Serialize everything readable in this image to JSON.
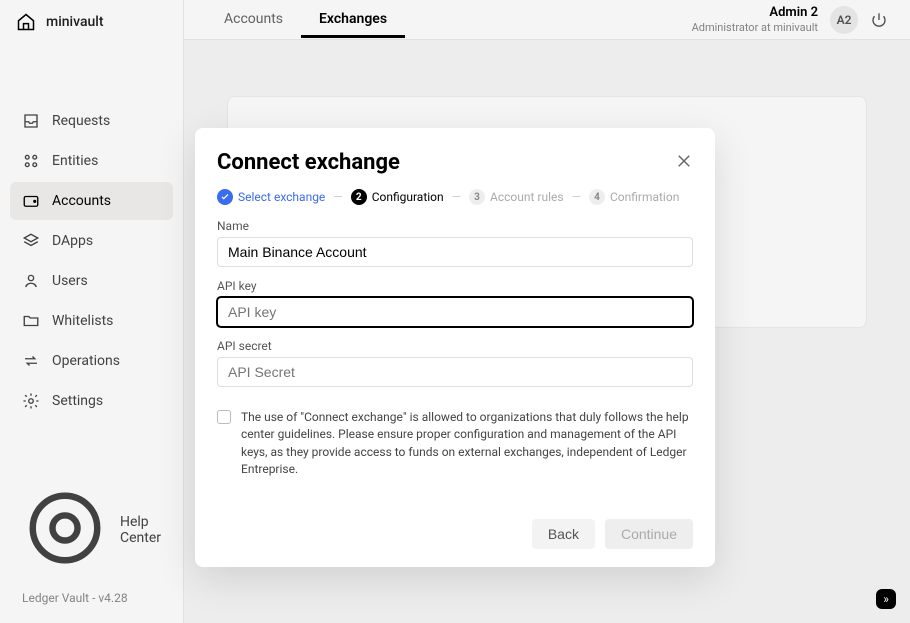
{
  "workspace": "minivault",
  "sidebar": {
    "items": [
      {
        "label": "Requests"
      },
      {
        "label": "Entities"
      },
      {
        "label": "Accounts"
      },
      {
        "label": "DApps"
      },
      {
        "label": "Users"
      },
      {
        "label": "Whitelists"
      },
      {
        "label": "Operations"
      },
      {
        "label": "Settings"
      }
    ],
    "help": "Help Center",
    "version": "Ledger Vault - v4.28"
  },
  "topbar": {
    "tabs": [
      {
        "label": "Accounts"
      },
      {
        "label": "Exchanges"
      }
    ],
    "user_name": "Admin 2",
    "user_role": "Administrator at minivault",
    "avatar": "A2"
  },
  "modal": {
    "title": "Connect exchange",
    "steps": [
      {
        "label": "Select exchange"
      },
      {
        "label": "Configuration"
      },
      {
        "label": "Account rules"
      },
      {
        "label": "Confirmation"
      }
    ],
    "step_numbers": {
      "s2": "2",
      "s3": "3",
      "s4": "4"
    },
    "name_label": "Name",
    "name_value": "Main Binance Account",
    "api_key_label": "API key",
    "api_key_placeholder": "API key",
    "api_secret_label": "API secret",
    "api_secret_placeholder": "API Secret",
    "consent_text": "The use of \"Connect exchange\" is allowed to organizations that duly follows the help center guidelines. Please ensure proper configuration and management of the API keys, as they provide access to funds on external exchanges, independent of Ledger Entreprise.",
    "back_label": "Back",
    "continue_label": "Continue"
  },
  "fab": "»"
}
